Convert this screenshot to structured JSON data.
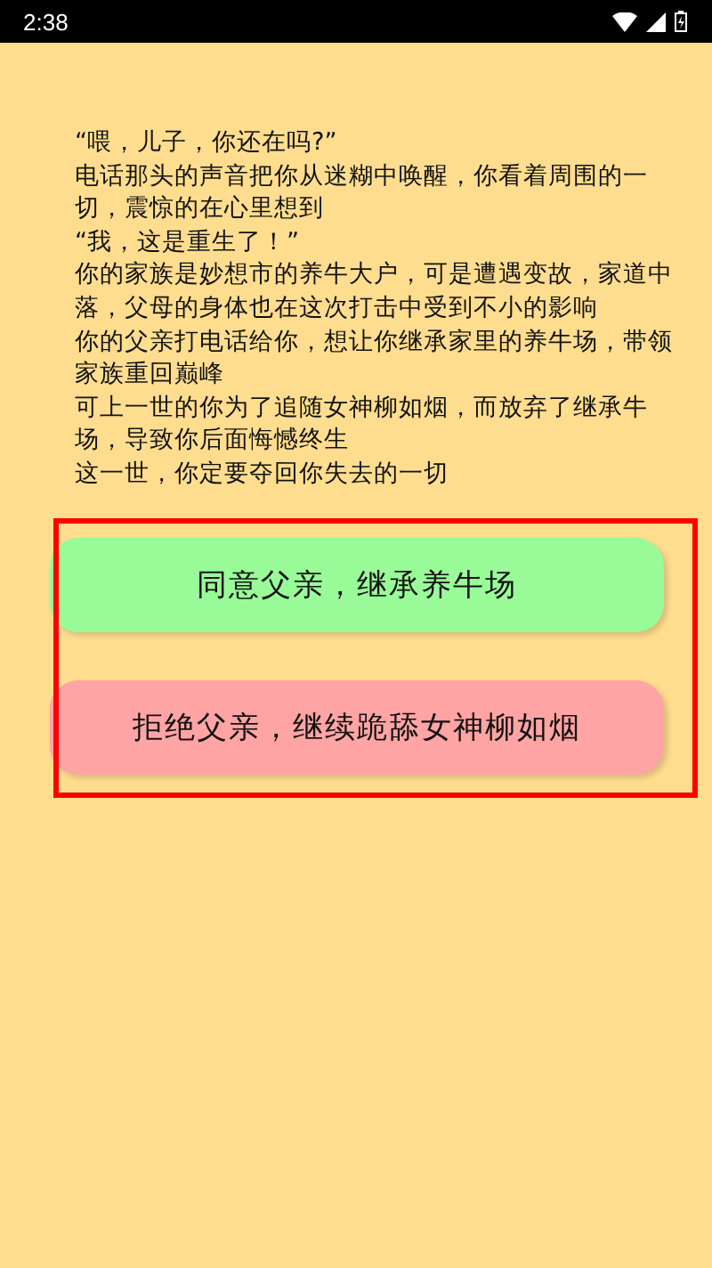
{
  "status_bar": {
    "time": "2:38"
  },
  "story": [
    "“喂，儿子，你还在吗?”",
    "电话那头的声音把你从迷糊中唤醒，你看着周围的一切，震惊的在心里想到",
    "“我，这是重生了！”",
    "你的家族是妙想市的养牛大户，可是遭遇变故，家道中落，父母的身体也在这次打击中受到不小的影响",
    "你的父亲打电话给你，想让你继承家里的养牛场，带领家族重回巅峰",
    "可上一世的你为了追随女神柳如烟，而放弃了继承牛场，导致你后面悔憾终生",
    "这一世，你定要夺回你失去的一切"
  ],
  "choices": [
    {
      "label": "同意父亲，继承养牛场",
      "color": "#98fb98"
    },
    {
      "label": "拒绝父亲，继续跪舔女神柳如烟",
      "color": "#ffa4a4"
    }
  ]
}
